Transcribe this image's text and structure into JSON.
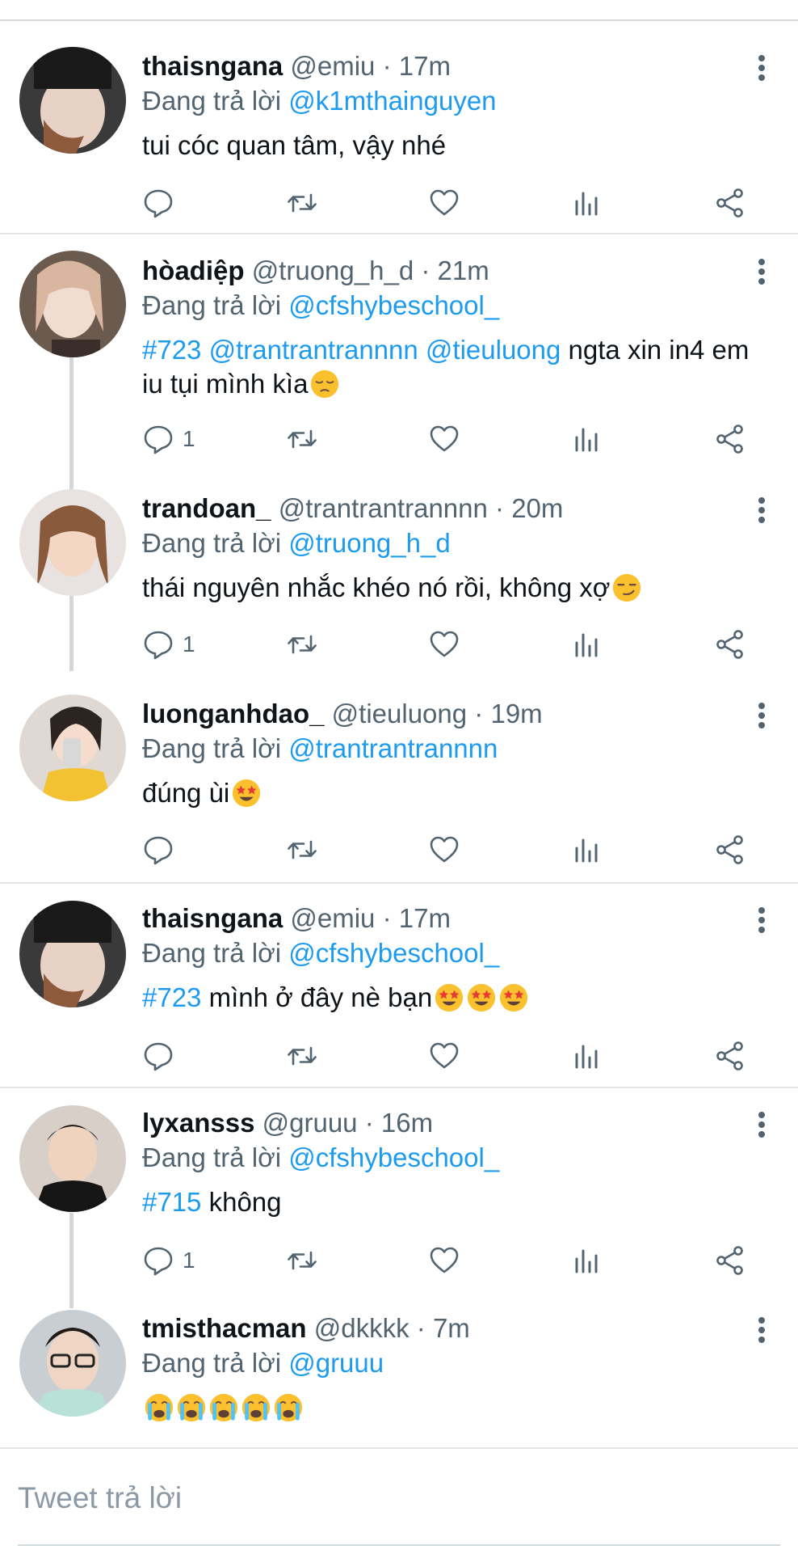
{
  "reply_prefix": "Đang trả lời",
  "tweets": [
    {
      "display_name": "thaisngana",
      "handle": "@emiu",
      "time": "17m",
      "reply_to": "@k1mthainguyen",
      "text_parts": [
        {
          "t": "tui cóc quan tâm, vậy nhé"
        }
      ],
      "reply_count": "",
      "avatar": "avatar-black-hair-girl"
    },
    {
      "display_name": "hòadiệp",
      "handle": "@truong_h_d",
      "time": "21m",
      "reply_to": "@cfshybeschool_",
      "text_parts": [
        {
          "t": "#723",
          "link": true
        },
        {
          "t": " "
        },
        {
          "t": "@trantrantrannnn",
          "link": true
        },
        {
          "t": " "
        },
        {
          "t": "@tieuluong",
          "link": true
        },
        {
          "t": " ngta xin in4 em iu tụi mình kìa"
        }
      ],
      "reply_count": "1",
      "avatar": "avatar-light-hair-girl"
    },
    {
      "display_name": "trandoan_",
      "handle": "@trantrantrannnn",
      "time": "20m",
      "reply_to": "@truong_h_d",
      "text_parts": [
        {
          "t": "thái nguyên nhắc khéo nó rồi, không xợ"
        }
      ],
      "reply_count": "1",
      "avatar": "avatar-brown-hair-girl"
    },
    {
      "display_name": "luonganhdao_",
      "handle": "@tieuluong",
      "time": "19m",
      "reply_to": "@trantrantrannnn",
      "text_parts": [
        {
          "t": "đúng ùi"
        }
      ],
      "reply_count": "",
      "avatar": "avatar-mirror-selfie-girl"
    },
    {
      "display_name": "thaisngana",
      "handle": "@emiu",
      "time": "17m",
      "reply_to": "@cfshybeschool_",
      "text_parts": [
        {
          "t": "#723",
          "link": true
        },
        {
          "t": " mình ở đây nè bạn"
        }
      ],
      "reply_count": "",
      "avatar": "avatar-black-hair-girl"
    },
    {
      "display_name": "lyxansss",
      "handle": "@gruuu",
      "time": "16m",
      "reply_to": "@cfshybeschool_",
      "text_parts": [
        {
          "t": "#715",
          "link": true
        },
        {
          "t": " không"
        }
      ],
      "reply_count": "1",
      "avatar": "avatar-boy-black-shirt"
    },
    {
      "display_name": "tmisthacman",
      "handle": "@dkkkk",
      "time": "7m",
      "reply_to": "@gruuu",
      "text_parts": [
        {
          "t": ""
        }
      ],
      "reply_count": "",
      "avatar": "avatar-boy-glasses"
    }
  ],
  "emoji": [
    "pensive-face",
    "smirking-face",
    "star-struck",
    "crying-face"
  ],
  "reply_placeholder": "Tweet trả lời",
  "colors": {
    "link": "#1d9bf0",
    "muted": "#536471",
    "text": "#0f1419"
  }
}
